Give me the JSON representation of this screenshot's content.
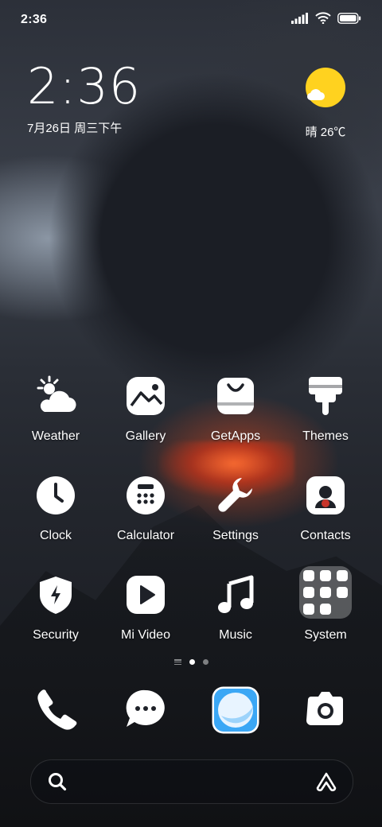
{
  "status_bar": {
    "time": "2:36"
  },
  "clock_widget": {
    "time": "2:36",
    "date": "7月26日 周三下午"
  },
  "weather_widget": {
    "condition": "晴",
    "temperature": "26℃",
    "text": "晴 26℃"
  },
  "apps": [
    {
      "label": "Weather",
      "icon": "weather-icon"
    },
    {
      "label": "Gallery",
      "icon": "gallery-icon"
    },
    {
      "label": "GetApps",
      "icon": "getapps-icon"
    },
    {
      "label": "Themes",
      "icon": "themes-icon"
    },
    {
      "label": "Clock",
      "icon": "clock-icon"
    },
    {
      "label": "Calculator",
      "icon": "calculator-icon"
    },
    {
      "label": "Settings",
      "icon": "settings-icon"
    },
    {
      "label": "Contacts",
      "icon": "contacts-icon"
    },
    {
      "label": "Security",
      "icon": "security-icon"
    },
    {
      "label": "Mi Video",
      "icon": "mi-video-icon"
    },
    {
      "label": "Music",
      "icon": "music-icon"
    },
    {
      "label": "System",
      "icon": "system-folder-icon"
    }
  ],
  "page_indicator": {
    "pages": 2,
    "current": 1
  },
  "dock": [
    {
      "icon": "phone-icon"
    },
    {
      "icon": "messages-icon"
    },
    {
      "icon": "browser-icon"
    },
    {
      "icon": "camera-icon"
    }
  ],
  "search_bar": {
    "left_icon": "search-icon",
    "right_icon": "assistant-icon"
  },
  "colors": {
    "sun": "#FFD21F",
    "browser_blue": "#3BA7F5"
  }
}
